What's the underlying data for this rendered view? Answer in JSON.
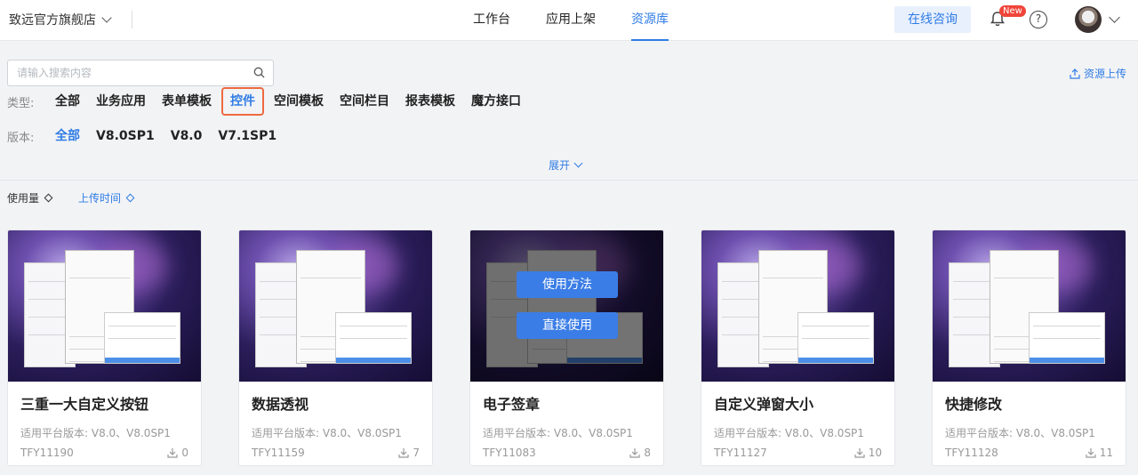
{
  "header": {
    "store_name": "致远官方旗舰店",
    "nav": [
      "工作台",
      "应用上架",
      "资源库"
    ],
    "active_nav": "资源库",
    "consult_label": "在线咨询",
    "new_badge": "New",
    "help_glyph": "?"
  },
  "search": {
    "placeholder": "请输入搜索内容",
    "value": ""
  },
  "upload_label": "资源上传",
  "type_filter": {
    "label": "类型:",
    "options": [
      "全部",
      "业务应用",
      "表单模板",
      "控件",
      "空间模板",
      "空间栏目",
      "报表模板",
      "魔方接口"
    ],
    "selected": "控件"
  },
  "version_filter": {
    "label": "版本:",
    "options": [
      "全部",
      "V8.0SP1",
      "V8.0",
      "V7.1SP1"
    ],
    "selected": "全部"
  },
  "expand_label": "展开",
  "sort": {
    "usage": "使用量",
    "upload_time": "上传时间"
  },
  "cards": [
    {
      "title": "三重一大自定义按钮",
      "version": "适用平台版本: V8.0、V8.0SP1",
      "id": "TFY11190",
      "downloads": "0"
    },
    {
      "title": "数据透视",
      "version": "适用平台版本: V8.0、V8.0SP1",
      "id": "TFY11159",
      "downloads": "7"
    },
    {
      "title": "电子签章",
      "version": "适用平台版本: V8.0、V8.0SP1",
      "id": "TFY11083",
      "downloads": "8",
      "hover_buttons": [
        "使用方法",
        "直接使用"
      ]
    },
    {
      "title": "自定义弹窗大小",
      "version": "适用平台版本: V8.0、V8.0SP1",
      "id": "TFY11127",
      "downloads": "10"
    },
    {
      "title": "快捷修改",
      "version": "适用平台版本: V8.0、V8.0SP1",
      "id": "TFY11128",
      "downloads": "11"
    }
  ],
  "colors": {
    "accent": "#2f7ce5",
    "highlight_border": "#ee6a40",
    "badge": "#f0453a"
  }
}
